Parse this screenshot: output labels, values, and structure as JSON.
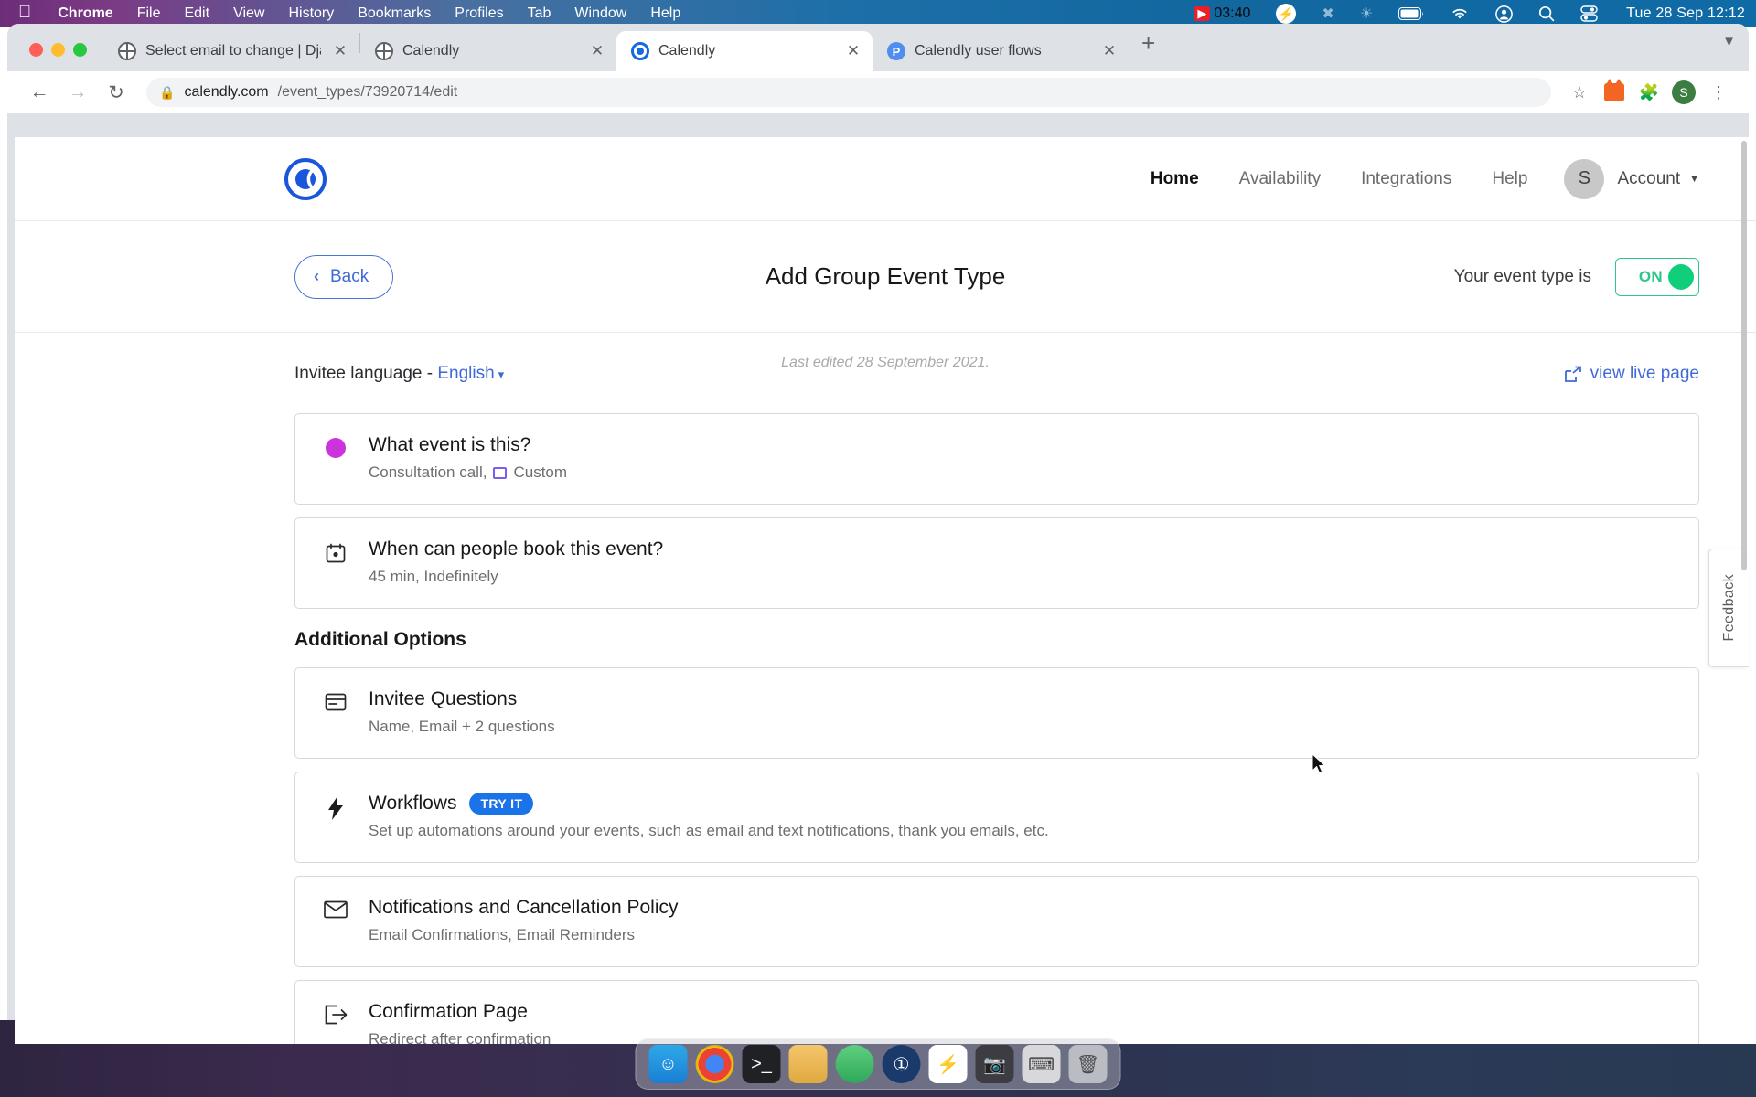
{
  "menubar": {
    "apple": "apple-logo",
    "items": [
      {
        "label": "Chrome",
        "bold": true
      },
      {
        "label": "File",
        "bold": false
      },
      {
        "label": "Edit",
        "bold": false
      },
      {
        "label": "View",
        "bold": false
      },
      {
        "label": "History",
        "bold": false
      },
      {
        "label": "Bookmarks",
        "bold": false
      },
      {
        "label": "Profiles",
        "bold": false
      },
      {
        "label": "Tab",
        "bold": false
      },
      {
        "label": "Window",
        "bold": false
      },
      {
        "label": "Help",
        "bold": false
      }
    ],
    "recording_time": "03:40",
    "clock": "Tue 28 Sep  12:12"
  },
  "browser": {
    "tabs": [
      {
        "title": "Select email to change | Django",
        "favicon": "globe-icon",
        "active": false
      },
      {
        "title": "Calendly",
        "favicon": "globe-icon",
        "active": false
      },
      {
        "title": "Calendly",
        "favicon": "calendly-icon",
        "active": true
      },
      {
        "title": "Calendly user flows",
        "favicon": "p-icon",
        "active": false
      }
    ],
    "new_tab": "+",
    "url_host": "calendly.com",
    "url_path": "/event_types/73920714/edit",
    "profile_initial": "S"
  },
  "nav": {
    "links": [
      {
        "label": "Home",
        "active": true
      },
      {
        "label": "Availability",
        "active": false
      },
      {
        "label": "Integrations",
        "active": false
      },
      {
        "label": "Help",
        "active": false
      }
    ],
    "avatar_initial": "S",
    "account_label": "Account"
  },
  "header": {
    "back_label": "Back",
    "title": "Add Group Event Type",
    "toggle_label": "Your event type is",
    "toggle_state": "ON"
  },
  "meta": {
    "language_prefix": "Invitee language - ",
    "language_value": "English",
    "last_edited": "Last edited 28 September 2021.",
    "view_live_page": "view live page"
  },
  "cards": [
    {
      "icon": "purple-dot-icon",
      "title": "What event is this?",
      "subtitle_before": "Consultation call,",
      "subtitle_badge": "mini-window-icon",
      "subtitle_after": "Custom"
    },
    {
      "icon": "calendar-icon",
      "title": "When can people book this event?",
      "subtitle": "45 min, Indefinitely"
    }
  ],
  "additional": {
    "section_title": "Additional Options",
    "items": [
      {
        "icon": "form-icon",
        "title": "Invitee Questions",
        "subtitle": "Name, Email + 2 questions"
      },
      {
        "icon": "bolt-icon",
        "title": "Workflows",
        "badge": "TRY IT",
        "subtitle": "Set up automations around your events, such as email and text notifications, thank you emails, etc."
      },
      {
        "icon": "envelope-icon",
        "title": "Notifications and Cancellation Policy",
        "subtitle": "Email Confirmations, Email Reminders"
      },
      {
        "icon": "exit-icon",
        "title": "Confirmation Page",
        "subtitle": "Redirect after confirmation"
      }
    ]
  },
  "feedback": {
    "label": "Feedback"
  },
  "colors": {
    "accent_blue": "#3f69d6",
    "toggle_green": "#0fcf7b",
    "badge_blue": "#1a73e8",
    "purple_dot": "#cc33dd"
  },
  "dock": {
    "items": [
      "finder-icon",
      "chrome-icon",
      "terminal-icon",
      "files-icon",
      "globe-icon",
      "onepassword-icon",
      "bolt-icon",
      "camera-icon",
      "keyboard-icon",
      "trash-icon"
    ]
  }
}
